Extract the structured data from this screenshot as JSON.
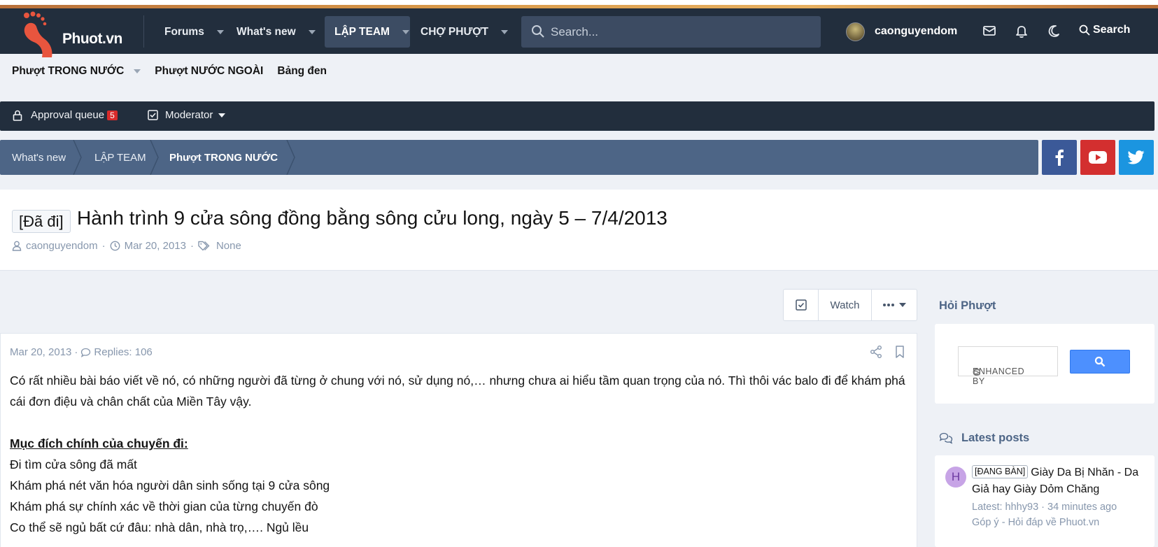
{
  "site": {
    "logo_text": "Phuot.vn"
  },
  "nav": [
    {
      "label": "Forums"
    },
    {
      "label": "What's new"
    },
    {
      "label": "LẬP TEAM"
    },
    {
      "label": "CHỢ PHƯỢT"
    }
  ],
  "search": {
    "placeholder": "Search..."
  },
  "user": {
    "name": "caonguyendom"
  },
  "header_search_label": "Search",
  "subnav": [
    {
      "label": "Phượt TRONG NƯỚC"
    },
    {
      "label": "Phượt NƯỚC NGOÀI"
    },
    {
      "label": "Bảng đen"
    }
  ],
  "modbar": {
    "approval_label": "Approval queue",
    "approval_count": "5",
    "moderator_label": "Moderator"
  },
  "breadcrumbs": [
    {
      "label": "What's new"
    },
    {
      "label": "LẬP TEAM"
    },
    {
      "label": "Phượt TRONG NƯỚC"
    }
  ],
  "colors": {
    "facebook": "#3b5998",
    "youtube": "#d32f2f",
    "twitter": "#1b95e0",
    "header": "#222e3d",
    "breadcrumb": "#4d6586"
  },
  "thread": {
    "prefix": "[Đã đi]",
    "title": "Hành trình 9 cửa sông đồng bằng sông cửu long, ngày 5 – 7/4/2013",
    "author": "caonguyendom",
    "date": "Mar 20, 2013",
    "tags": "None",
    "watch_label": "Watch"
  },
  "post": {
    "date": "Mar 20, 2013",
    "replies": "Replies: 106",
    "paragraph": "Có rất nhiều bài báo viết về nó, có những người đã từng ở chung với nó, sử dụng nó,… nhưng chưa ai hiểu tầm quan trọng của nó. Thì thôi vác balo đi để khám phá cái đơn điệu và chân chất của Miền Tây vậy.",
    "heading": "Mục đích chính của chuyến đi:",
    "lines": [
      "Đi tìm cửa sông đã mất",
      "Khám phá nét văn hóa người dân sinh sống tại 9 cửa sông",
      "Khám phá sự chính xác về thời gian của từng chuyến đò",
      "Co thể sẽ ngủ bất cứ đâu: nhà dân, nhà trọ,…. Ngủ lều"
    ]
  },
  "sidebar": {
    "hoi_phuot": "Hỏi Phượt",
    "google_placeholder": "ENHANCED BY",
    "latest_heading": "Latest posts",
    "latest": {
      "avatar_letter": "H",
      "tag": "[ĐANG BÀN]",
      "title": "Giày Da Bị Nhăn - Da Giả hay Giày Dỏm Chăng",
      "latest_line": "Latest: hhhy93 · 34 minutes ago",
      "forum": "Góp ý - Hỏi đáp về Phuot.vn"
    }
  }
}
